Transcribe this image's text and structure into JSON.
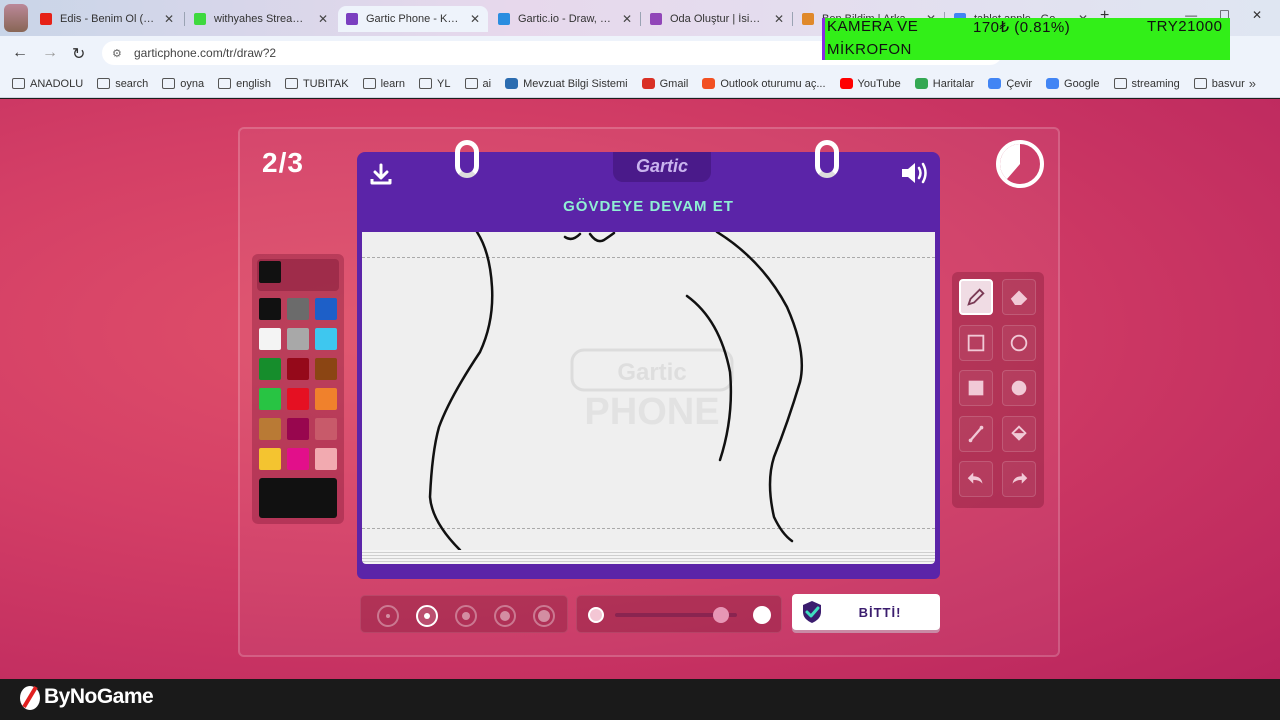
{
  "browser": {
    "tabs": [
      {
        "label": "Edis - Benim Ol (Offic",
        "favicon_color": "#e62117"
      },
      {
        "label": "withyahes Stream - K",
        "favicon_color": "#3ed93e"
      },
      {
        "label": "Gartic Phone - Kulak",
        "favicon_color": "#7b3fc0"
      },
      {
        "label": "Gartic.io - Draw, Gue",
        "favicon_color": "#2a8de0"
      },
      {
        "label": "Oda Oluştur | İsim Şe",
        "favicon_color": "#9146b8"
      },
      {
        "label": "Ben Bildim | Arkadaş",
        "favicon_color": "#e0892a"
      },
      {
        "label": "tablet apple - Google",
        "favicon_color": "#4285f4"
      }
    ],
    "url": "garticphone.com/tr/draw?2",
    "bookmarks": [
      {
        "label": "ANADOLU",
        "type": "folder"
      },
      {
        "label": "search",
        "type": "folder"
      },
      {
        "label": "oyna",
        "type": "folder"
      },
      {
        "label": "english",
        "type": "folder"
      },
      {
        "label": "TUBITAK",
        "type": "folder"
      },
      {
        "label": "learn",
        "type": "folder"
      },
      {
        "label": "YL",
        "type": "folder"
      },
      {
        "label": "ai",
        "type": "folder"
      },
      {
        "label": "Mevzuat Bilgi Sistemi",
        "type": "site",
        "color": "#2b6cb0"
      },
      {
        "label": "Gmail",
        "type": "site",
        "color": "#d93025"
      },
      {
        "label": "Outlook oturumu aç...",
        "type": "site",
        "color": "#f25022"
      },
      {
        "label": "YouTube",
        "type": "site",
        "color": "#ff0000"
      },
      {
        "label": "Haritalar",
        "type": "site",
        "color": "#34a853"
      },
      {
        "label": "Çevir",
        "type": "site",
        "color": "#4285f4"
      },
      {
        "label": "Google",
        "type": "site",
        "color": "#4285f4"
      },
      {
        "label": "streaming",
        "type": "folder"
      },
      {
        "label": "basvur",
        "type": "folder"
      }
    ],
    "more_bookmarks": "»"
  },
  "stream_overlay": {
    "line1": "KAMERA VE",
    "line2": "MİKROFON",
    "amount": "170₺ (0.81%)",
    "goal": "TRY21000"
  },
  "game": {
    "round": "2/3",
    "logo": "Gartic",
    "task_title": "GÖVDEYE DEVAM ET",
    "watermark_line1": "Gartic",
    "watermark_line2": "PHONE",
    "done_label": "BİTTİ!",
    "selected_color": "#111111",
    "palette": [
      [
        "#111111",
        "#6b6b6b",
        "#1d5fc8"
      ],
      [
        "#f4f4f4",
        "#a8a8a8",
        "#3ec7ef"
      ],
      [
        "#168d2c",
        "#95091a",
        "#8b4513"
      ],
      [
        "#28c443",
        "#e51022",
        "#f0812c"
      ],
      [
        "#b97a35",
        "#98064e",
        "#c85a6a"
      ],
      [
        "#f4c430",
        "#e20f8a",
        "#f2aab0"
      ]
    ],
    "tools": [
      {
        "name": "pencil",
        "active": true
      },
      {
        "name": "eraser",
        "active": false
      },
      {
        "name": "rectangle-outline",
        "active": false
      },
      {
        "name": "ellipse-outline",
        "active": false
      },
      {
        "name": "rectangle-filled",
        "active": false
      },
      {
        "name": "ellipse-filled",
        "active": false
      },
      {
        "name": "line",
        "active": false
      },
      {
        "name": "fill-bucket",
        "active": false
      },
      {
        "name": "undo",
        "active": false
      },
      {
        "name": "redo",
        "active": false
      }
    ],
    "brush_sizes": [
      1,
      2,
      3,
      4,
      5
    ],
    "selected_brush_size": 2,
    "opacity": 0.87
  },
  "footer": {
    "brand": "ByNoGame"
  }
}
